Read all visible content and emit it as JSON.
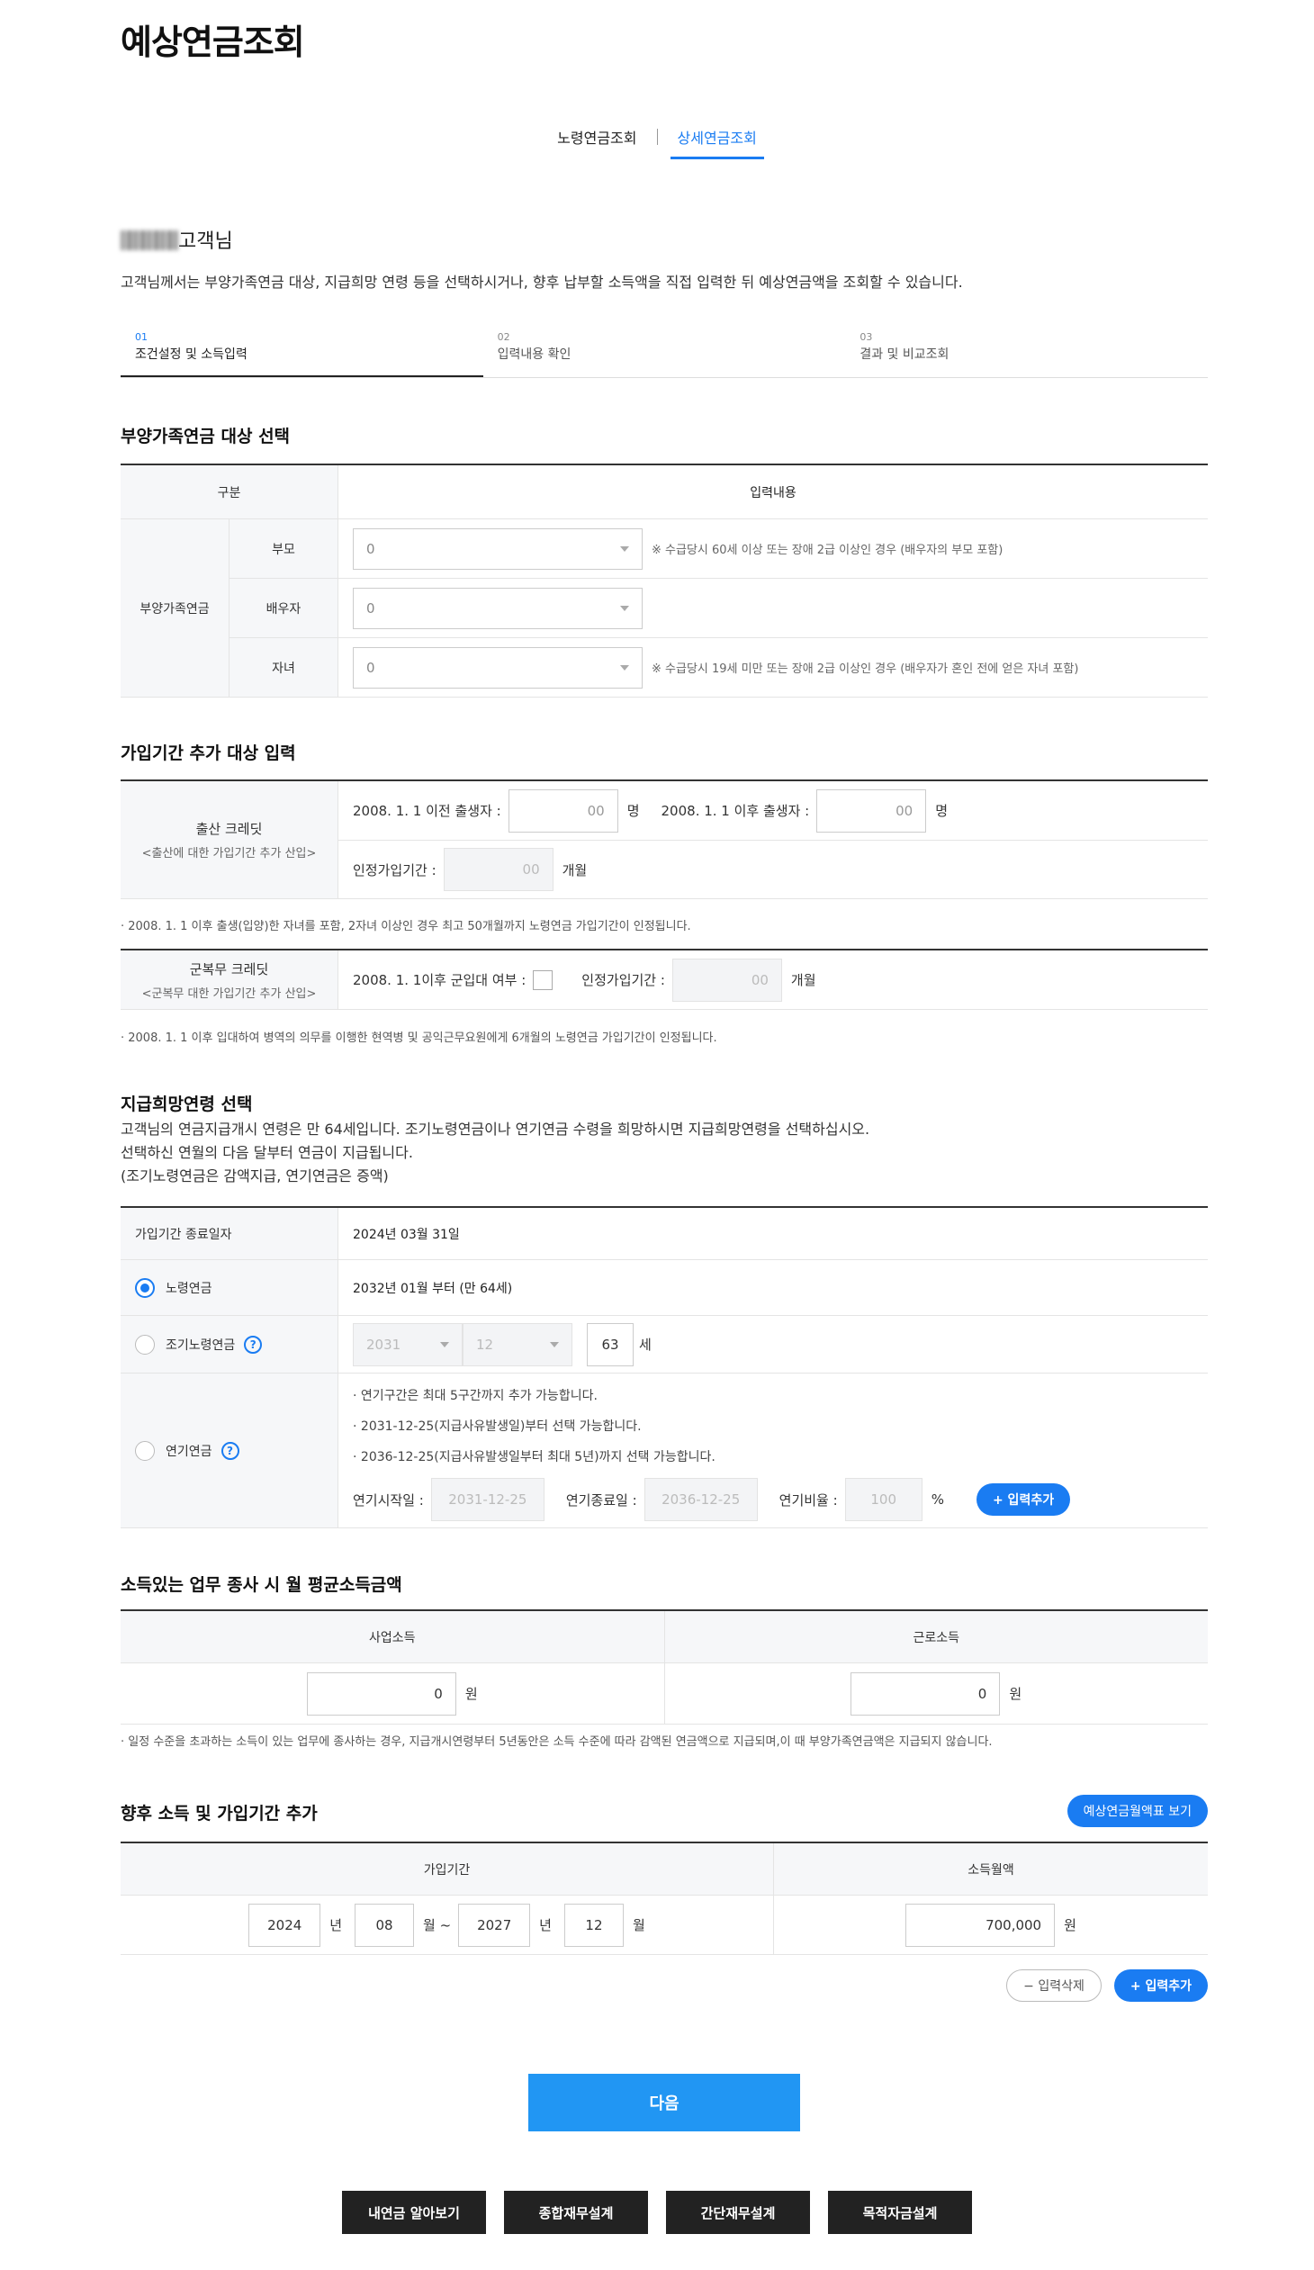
{
  "page_title": "예상연금조회",
  "tabs": [
    {
      "label": "노령연금조회"
    },
    {
      "label": "상세연금조회"
    }
  ],
  "customer": {
    "suffix": "고객님"
  },
  "intro": "고객님께서는 부양가족연금 대상, 지급희망 연령 등을 선택하시거나, 향후 납부할 소득액을 직접 입력한 뒤 예상연금액을 조회할 수 있습니다.",
  "steps": [
    {
      "num": "01",
      "label": "조건설정 및 소득입력"
    },
    {
      "num": "02",
      "label": "입력내용 확인"
    },
    {
      "num": "03",
      "label": "결과 및 비교조회"
    }
  ],
  "dependents": {
    "title": "부양가족연금 대상 선택",
    "col_category": "구분",
    "col_input": "입력내용",
    "group": "부양가족연금",
    "rows": [
      {
        "label": "부모",
        "value": "0",
        "note": "※ 수급당시 60세 이상 또는 장애 2급 이상인 경우 (배우자의 부모 포함)"
      },
      {
        "label": "배우자",
        "value": "0",
        "note": ""
      },
      {
        "label": "자녀",
        "value": "0",
        "note": "※ 수급당시 19세 미만 또는 장애 2급 이상인 경우 (배우자가 혼인 전에 얻은 자녀 포함)"
      }
    ]
  },
  "credit": {
    "title": "가입기간 추가 대상 입력",
    "birth_title": "출산 크레딧",
    "birth_sub": "<출산에 대한 가입기간 추가 산입>",
    "before_label": "2008. 1. 1 이전 출생자 :",
    "before_value": "00",
    "after_label": "2008. 1. 1 이후 출생자 :",
    "after_value": "00",
    "person_unit": "명",
    "recognized_label": "인정가입기간 :",
    "recognized_value": "00",
    "month_unit": "개월",
    "birth_note": "2008. 1. 1 이후 출생(입양)한 자녀를 포함, 2자녀 이상인 경우 최고 50개월까지 노령연금 가입기간이 인정됩니다.",
    "military_title": "군복무 크레딧",
    "military_sub": "<군복무 대한 가입기간 추가 산입>",
    "military_label": "2008. 1. 1이후 군입대 여부 :",
    "military_recognized_label": "인정가입기간 :",
    "military_value": "00",
    "military_note": "2008. 1. 1 이후 입대하여 병역의 의무를 이행한 현역병 및 공익근무요원에게 6개월의 노령연금 가입기간이 인정됩니다."
  },
  "age": {
    "title": "지급희망연령 선택",
    "desc": [
      "고객님의 연금지급개시 연령은 만 64세입니다. 조기노령연금이나 연기연금 수령을 희망하시면 지급희망연령을 선택하십시오.",
      "선택하신 연월의 다음 달부터 연금이 지급됩니다.",
      "(조기노령연금은 감액지급, 연기연금은 증액)"
    ],
    "end_label": "가입기간 종료일자",
    "end_value": "2024년 03월 31일",
    "old_label": "노령연금",
    "old_value": "2032년 01월 부터 (만 64세)",
    "early_label": "조기노령연금",
    "early_year": "2031",
    "early_month": "12",
    "early_age": "63",
    "age_unit": "세",
    "deferred_label": "연기연금",
    "deferred_notes": [
      "연기구간은 최대 5구간까지 추가 가능합니다.",
      "2031-12-25(지급사유발생일)부터 선택 가능합니다.",
      "2036-12-25(지급사유발생일부터 최대 5년)까지 선택 가능합니다."
    ],
    "start_label": "연기시작일 :",
    "start_value": "2031-12-25",
    "stop_label": "연기종료일 :",
    "stop_value": "2036-12-25",
    "ratio_label": "연기비율 :",
    "ratio_value": "100",
    "percent_unit": "%",
    "add_button": "+ 입력추가",
    "help_icon": "?"
  },
  "income": {
    "title": "소득있는 업무 종사 시 월 평균소득금액",
    "business_label": "사업소득",
    "labor_label": "근로소득",
    "business_value": "0",
    "labor_value": "0",
    "won_unit": "원",
    "note": "일정 수준을 초과하는 소득이 있는 업무에 종사하는 경우, 지급개시연령부터 5년동안은 소득 수준에 따라 감액된 연금액으로 지급되며,이 때 부양가족연금액은 지급되지 않습니다."
  },
  "future": {
    "title": "향후 소득 및 가입기간 추가",
    "table_button": "예상연금월액표 보기",
    "period_label": "가입기간",
    "income_label": "소득월액",
    "start_year": "2024",
    "start_month": "08",
    "end_year": "2027",
    "end_month": "12",
    "year_unit": "년",
    "month_unit": "월",
    "tilde": "월 ~",
    "income_value": "700,000",
    "won_unit": "원",
    "delete_button": "− 입력삭제",
    "add_button": "+ 입력추가"
  },
  "next_button": "다음",
  "bottom_buttons": [
    {
      "label": "내연금 알아보기"
    },
    {
      "label": "종합재무설계"
    },
    {
      "label": "간단재무설계"
    },
    {
      "label": "목적자금설계"
    }
  ]
}
